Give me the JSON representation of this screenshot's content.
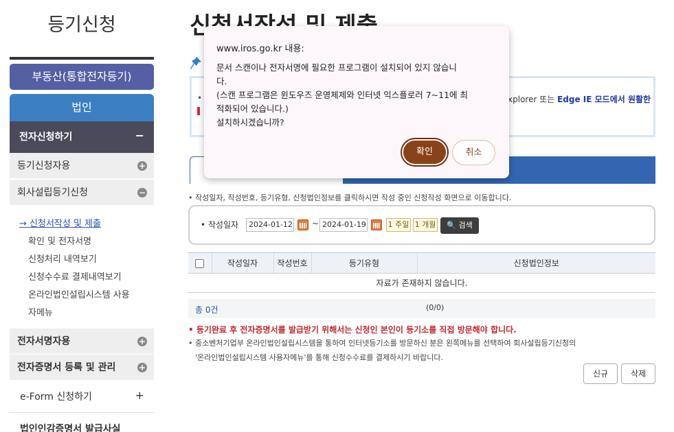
{
  "sidebar": {
    "title": "등기신청",
    "realty_button": "부동산(통합전자등기)",
    "corp_button": "법인",
    "ebiz_menu": {
      "label": "전자신청하기",
      "mark": "−"
    },
    "menu_rows": [
      {
        "label": "등기신청자용",
        "mark": "+"
      },
      {
        "label": "회사설립등기신청",
        "mark": "−"
      }
    ],
    "sub_items": [
      "→ 신청서작성 및 제출",
      "확인 및 전자서명",
      "신청처리 내역보기",
      "신청수수료 결제내역보기",
      "온라인법인설립시스템 사용",
      "자메뉴"
    ],
    "lower_rows": [
      {
        "label": "전자서명자용",
        "mark": "+"
      },
      {
        "label": "전자증명서 등록 및 관리",
        "mark": "+"
      }
    ],
    "eform": {
      "label": "e-Form 신청하기",
      "mark": "+"
    },
    "last_item": "법인인감증명서 발급사실"
  },
  "main": {
    "heading": "신청서작성 및 제출",
    "notice_visible_text": "xplorer 또는 ",
    "notice_visible_bold": "Edge IE 모드에서 원활한",
    "guide": "• 작성일자, 작성번호, 등기유형, 신청법인정보를 클릭하시면 작성 중인 신청작성 화면으로 이동합니다.",
    "search": {
      "label": "• 작성일자",
      "from": "2024-01-12",
      "tilde": "~",
      "to": "2024-01-19",
      "week_btn": "1 주일",
      "month_btn": "1 개월",
      "search_btn": "🔍 검색"
    },
    "table": {
      "headers": [
        "작성일자",
        "작성번호",
        "등기유형",
        "신청법인정보"
      ],
      "empty": "자료가 존재하지 않습니다."
    },
    "total": "총 0건",
    "pager": "(0/0)",
    "warning": "• 등기완료 후 전자증명서를 발급받기 위해서는 신청인 본인이 등기소를 직접 방문해야 합니다.",
    "info1": "• 중소벤처기업부 온라인법인설립시스템을 통하여 인터넷등기소를 방문하신 분은 왼쪽메뉴를 선택하여 회사설립등기신청의",
    "info2": "'온라인법인설립시스템 사용자메뉴'를 통해 신청수수료를 결제하시기 바랍니다.",
    "new_btn": "신규",
    "delete_btn": "삭제"
  },
  "dialog": {
    "title": "www.iros.go.kr 내용:",
    "message": "문서 스캔이나 전자서명에 필요한 프로그램이 설치되어 있지 않습니\n다.\n(스캔 프로그램은 윈도우즈 운영체제와 인터넷 익스플로러 7~11에 최\n적화되어 있습니다.)\n설치하시겠습니까?",
    "ok": "확인",
    "cancel": "취소"
  }
}
